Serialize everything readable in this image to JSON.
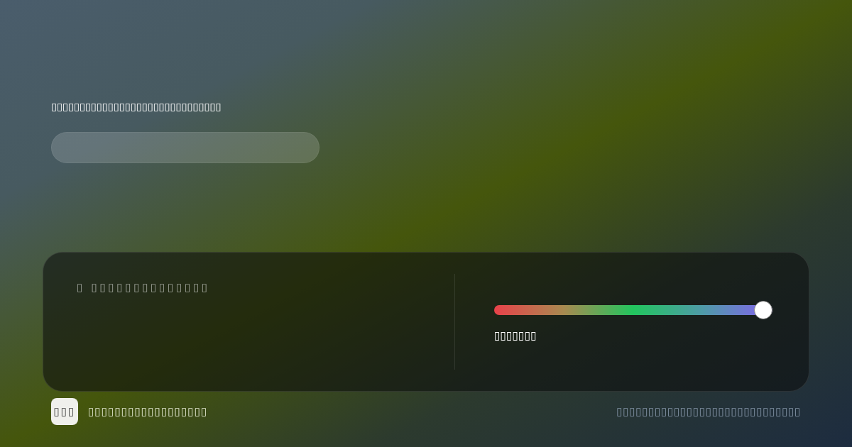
{
  "heading": "▯▯▯▯▯▯▯▯▯▯▯▯▯▯▯▯▯▯▯▯▯▯▯▯▯▯▯▯▯▯",
  "panel": {
    "label": "▯ ▯▯▯▯▯▯▯▯▯▯▯▯▯▯",
    "slider": {
      "level": 1,
      "label": "▯▯▯▯▯▯▯"
    }
  },
  "footer": {
    "logo": "▯▯▯",
    "title": "▯▯▯▯▯▯▯▯▯▯▯▯▯▯▯▯▯▯",
    "note": "▯▯▯▯▯▯▯▯▯▯▯▯▯▯▯▯▯▯▯▯▯▯▯▯▯▯▯▯▯"
  }
}
